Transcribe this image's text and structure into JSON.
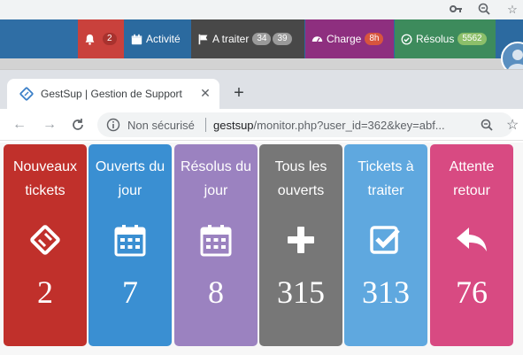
{
  "navbar": {
    "notifications": {
      "count": "2"
    },
    "activity": {
      "label": "Activité"
    },
    "todo": {
      "label": "A traiter",
      "badge1": "34",
      "badge2": "39"
    },
    "load": {
      "label": "Charge",
      "badge": "8h"
    },
    "resolved": {
      "label": "Résolus",
      "badge": "5562"
    }
  },
  "browser": {
    "tab_title": "GestSup | Gestion de Support",
    "security_label": "Non sécurisé",
    "url_host": "gestsup",
    "url_path": "/monitor.php?user_id=362&key=abf..."
  },
  "tiles": [
    {
      "label": "Nouveaux tickets",
      "icon": "ticket-icon",
      "count": "2",
      "color": "#c0302b"
    },
    {
      "label": "Ouverts du jour",
      "icon": "calendar-icon",
      "count": "7",
      "color": "#3a8fd2"
    },
    {
      "label": "Résolus du jour",
      "icon": "calendar-icon",
      "count": "8",
      "color": "#9b82c0"
    },
    {
      "label": "Tous les ouverts",
      "icon": "plus-icon",
      "count": "315",
      "color": "#777777"
    },
    {
      "label": "Tickets à traiter",
      "icon": "check-square-icon",
      "count": "313",
      "color": "#5fa8df"
    },
    {
      "label": "Attente retour",
      "icon": "reply-icon",
      "count": "76",
      "color": "#d84a82"
    }
  ]
}
